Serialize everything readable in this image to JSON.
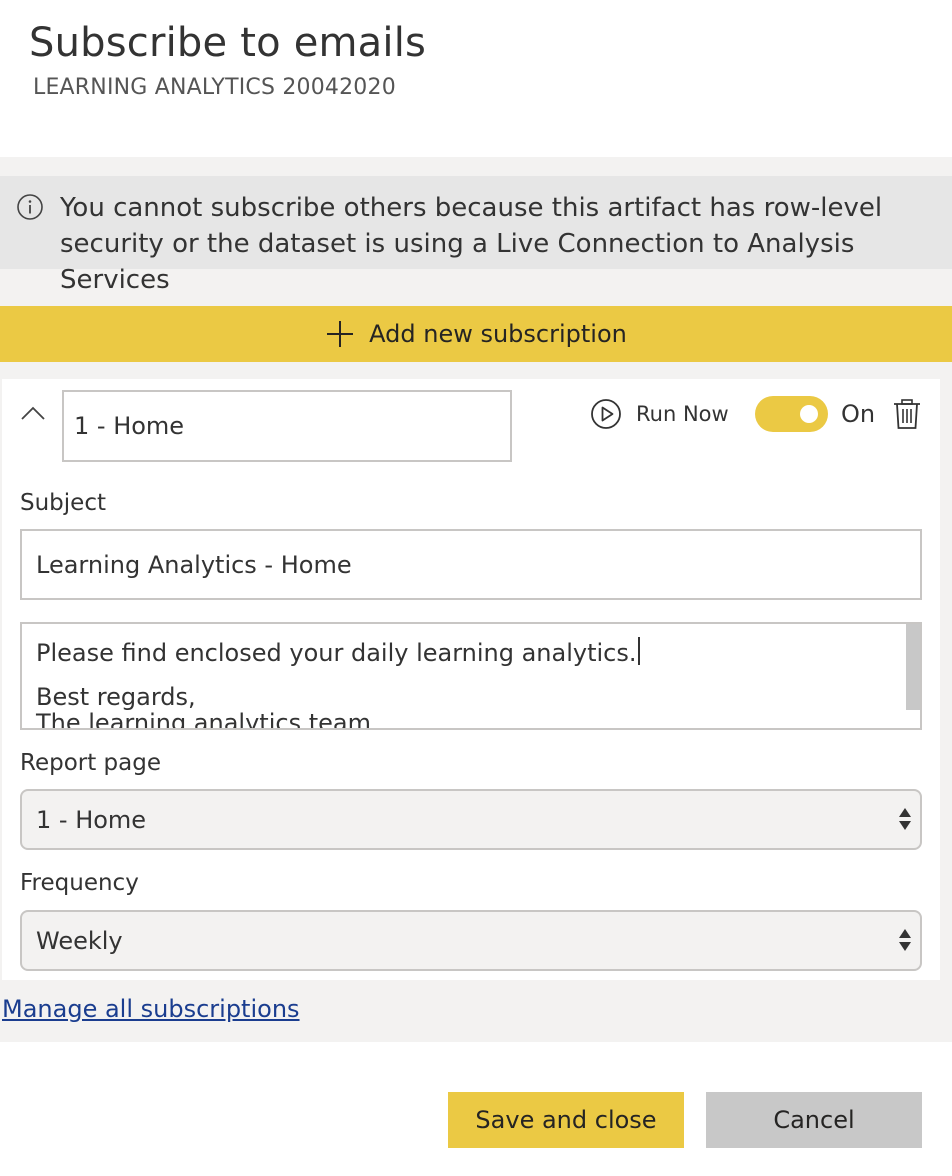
{
  "dialog": {
    "title": "Subscribe to emails",
    "subtitle": "LEARNING ANALYTICS 20042020"
  },
  "info": {
    "icon": "info-icon",
    "message": "You cannot subscribe others because this artifact has row-level security or the dataset is using a Live Connection to Analysis Services"
  },
  "add_subscription": {
    "icon": "plus-icon",
    "label": "Add new subscription"
  },
  "subscription": {
    "name": "1 - Home",
    "run_now_label": "Run Now",
    "toggle_label": "On",
    "toggle_on": true,
    "subject_label": "Subject",
    "subject_value": "Learning Analytics - Home",
    "message_line1": "Please find enclosed your daily learning analytics.",
    "message_line2": "Best regards,",
    "message_line3": "The learning analytics team",
    "report_page_label": "Report page",
    "report_page_value": "1 - Home",
    "frequency_label": "Frequency",
    "frequency_value": "Weekly"
  },
  "links": {
    "manage": "Manage all subscriptions"
  },
  "footer": {
    "save_label": "Save and close",
    "cancel_label": "Cancel"
  },
  "colors": {
    "accent": "#ebc944",
    "panel": "#f3f2f1",
    "info_bg": "#e6e6e6",
    "link": "#1a3d8f",
    "cancel_bg": "#c8c8c8"
  }
}
